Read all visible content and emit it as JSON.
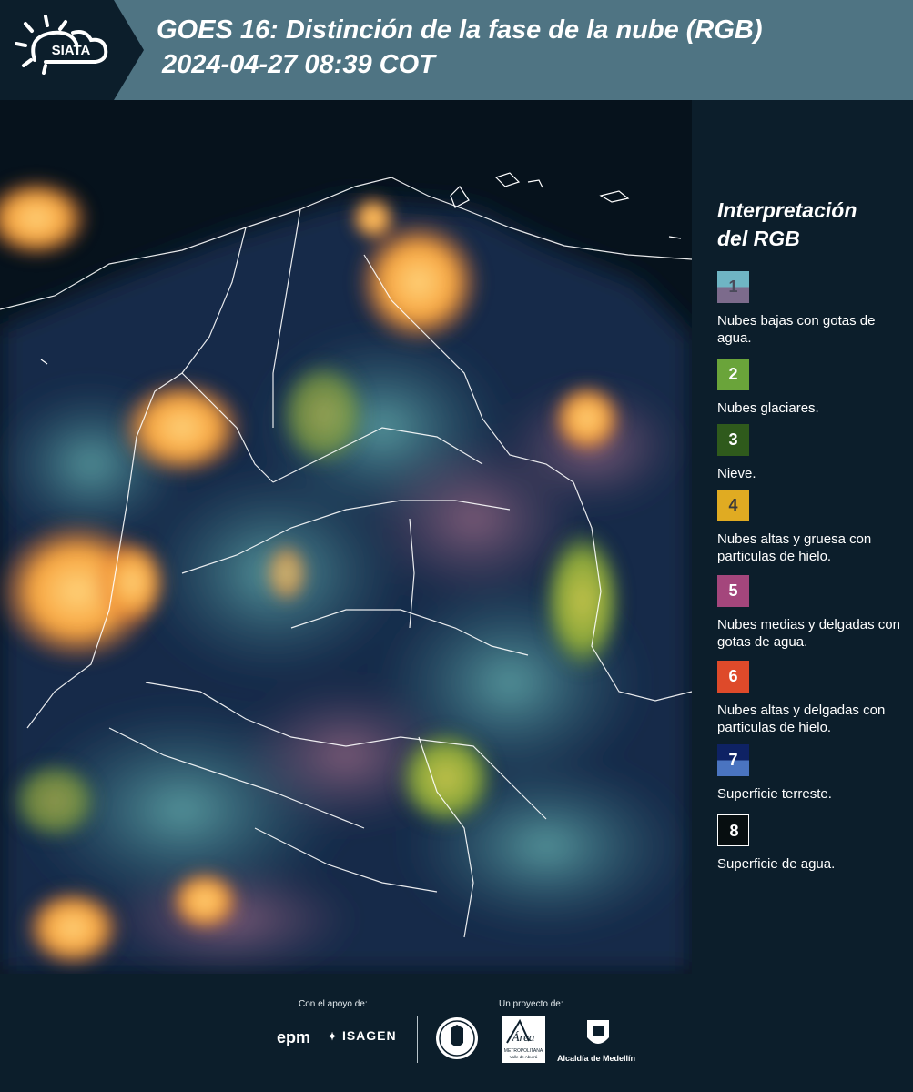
{
  "header": {
    "logo_text": "SIATA",
    "title_line1": "GOES 16: Distinción de la fase de la nube (RGB)",
    "title_line2": "2024-04-27 08:39 COT"
  },
  "legend": {
    "title_line1": "Interpretación",
    "title_line2": "del RGB",
    "items": [
      {
        "number": "1",
        "label": "Nubes bajas con gotas de agua.",
        "color_top": "#6fb5c4",
        "color_bottom": "#7c6b8c",
        "text_color": "#4a4a5a"
      },
      {
        "number": "2",
        "label": "Nubes glaciares.",
        "color_top": "#6aa43a",
        "color_bottom": "#6aa43a",
        "text_color": "#ffffff"
      },
      {
        "number": "3",
        "label": "Nieve.",
        "color_top": "#2f5a1c",
        "color_bottom": "#2f5a1c",
        "text_color": "#ffffff"
      },
      {
        "number": "4",
        "label": "Nubes altas y gruesa con particulas de hielo.",
        "color_top": "#e0ab22",
        "color_bottom": "#e0ab22",
        "text_color": "#3a3a3a"
      },
      {
        "number": "5",
        "label": "Nubes medias y delgadas con gotas de agua.",
        "color_top": "#a4467c",
        "color_bottom": "#a4467c",
        "text_color": "#ffffff"
      },
      {
        "number": "6",
        "label": "Nubes altas y delgadas con particulas de hielo.",
        "color_top": "#de4a2a",
        "color_bottom": "#de4a2a",
        "text_color": "#ffffff"
      },
      {
        "number": "7",
        "label": "Superficie terreste.",
        "color_top": "#0e2264",
        "color_bottom": "#4a74c0",
        "text_color": "#ffffff"
      },
      {
        "number": "8",
        "label": "Superficie de agua.",
        "color_top": "#070e10",
        "color_bottom": "#070e10",
        "text_color": "#ffffff"
      }
    ]
  },
  "footer": {
    "support_label": "Con el apoyo de:",
    "project_label": "Un proyecto de:",
    "sponsor1": "epm",
    "sponsor2": "ISAGEN",
    "partner_area": "Área",
    "partner_area_sub": "METROPOLITANA",
    "partner_area_sub2": "Valle de Aburrá",
    "partner_alcaldia": "Alcaldía de Medellín"
  },
  "colors": {
    "header_bg": "#4f7483",
    "page_bg": "#0c1e2b",
    "logo_bg": "#0c1e2b"
  }
}
